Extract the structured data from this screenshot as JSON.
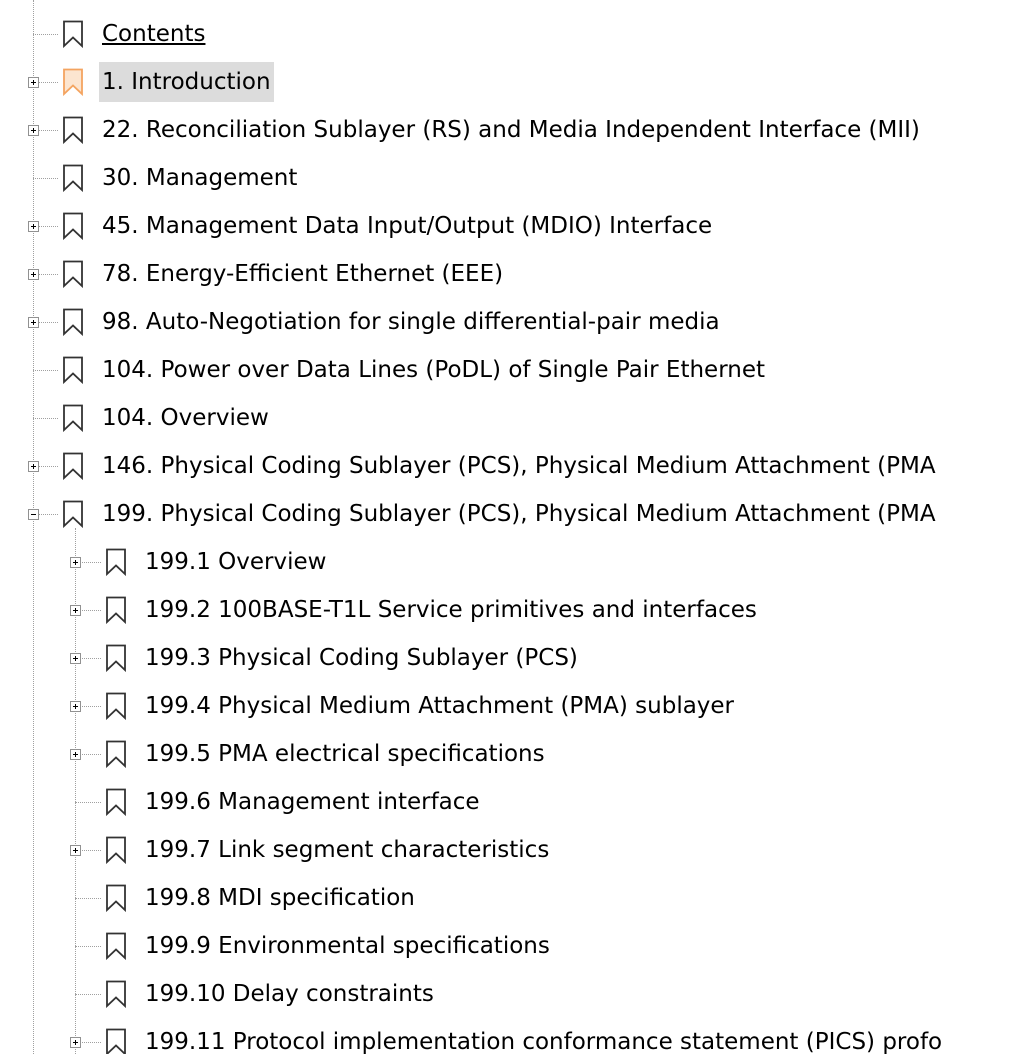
{
  "bookmarks_panel": {
    "items": [
      {
        "label": "Contents",
        "level": 0,
        "expander": "none",
        "underline": true
      },
      {
        "label": "1. Introduction",
        "level": 0,
        "expander": "plus",
        "selected": true,
        "icon": "bookmark-icon-highlighted"
      },
      {
        "label": "22. Reconciliation Sublayer (RS) and Media Independent Interface (MII)",
        "level": 0,
        "expander": "plus"
      },
      {
        "label": "30. Management",
        "level": 0,
        "expander": "none"
      },
      {
        "label": "45. Management Data Input/Output (MDIO) Interface",
        "level": 0,
        "expander": "plus"
      },
      {
        "label": "78. Energy-Efficient Ethernet (EEE)",
        "level": 0,
        "expander": "plus"
      },
      {
        "label": "98. Auto-Negotiation for single differential-pair media",
        "level": 0,
        "expander": "plus"
      },
      {
        "label": "104. Power over Data Lines (PoDL) of Single Pair Ethernet",
        "level": 0,
        "expander": "none"
      },
      {
        "label": "104. Overview",
        "level": 0,
        "expander": "none"
      },
      {
        "label": "146. Physical Coding Sublayer (PCS), Physical Medium Attachment (PMA",
        "level": 0,
        "expander": "plus"
      },
      {
        "label": "199. Physical Coding Sublayer (PCS), Physical Medium Attachment (PMA",
        "level": 0,
        "expander": "minus"
      },
      {
        "label": "199.1 Overview",
        "level": 1,
        "expander": "plus"
      },
      {
        "label": "199.2 100BASE-T1L Service primitives and interfaces",
        "level": 1,
        "expander": "plus"
      },
      {
        "label": "199.3 Physical Coding Sublayer (PCS)",
        "level": 1,
        "expander": "plus"
      },
      {
        "label": "199.4 Physical Medium Attachment (PMA) sublayer",
        "level": 1,
        "expander": "plus"
      },
      {
        "label": "199.5 PMA electrical specifications",
        "level": 1,
        "expander": "plus"
      },
      {
        "label": "199.6 Management interface",
        "level": 1,
        "expander": "none"
      },
      {
        "label": "199.7 Link segment characteristics",
        "level": 1,
        "expander": "plus"
      },
      {
        "label": "199.8 MDI specification",
        "level": 1,
        "expander": "none"
      },
      {
        "label": "199.9 Environmental specifications",
        "level": 1,
        "expander": "none"
      },
      {
        "label": "199.10 Delay constraints",
        "level": 1,
        "expander": "none"
      },
      {
        "label": "199.11 Protocol implementation conformance statement (PICS) profo",
        "level": 1,
        "expander": "plus"
      }
    ]
  },
  "colors": {
    "selected_background": "#dcdcdc",
    "highlight_bookmark": "#f4a460",
    "bookmark_outline": "#333333",
    "tree_line": "#a0a0a0"
  }
}
